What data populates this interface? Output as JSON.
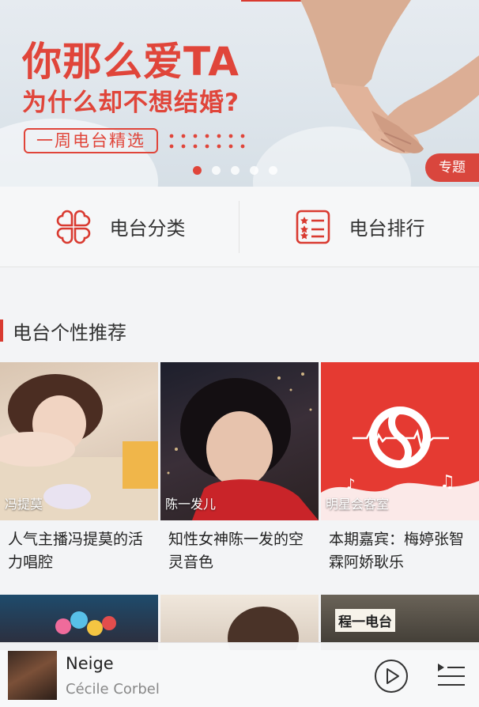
{
  "banner": {
    "title_line1": "你那么爱TA",
    "title_line2": "为什么却不想结婚?",
    "weekly_label": "一周电台精选",
    "tag": "专题",
    "active_slide": 1,
    "slide_count": 5
  },
  "entries": [
    {
      "label": "电台分类",
      "icon": "grid-icon"
    },
    {
      "label": "电台排行",
      "icon": "rank-list-icon"
    }
  ],
  "section": {
    "title": "电台个性推荐"
  },
  "cards": [
    {
      "caption": "冯提莫",
      "title": "人气主播冯提莫的活力唱腔"
    },
    {
      "caption": "陈一发儿",
      "title": "知性女神陈一发的空灵音色"
    },
    {
      "caption": "明星会客室",
      "title": "本期嘉宾：梅婷张智霖阿娇耿乐"
    }
  ],
  "row2_cards": [
    {
      "overlay_text": ""
    },
    {
      "overlay_text": ""
    },
    {
      "overlay_text": "程一电台"
    }
  ],
  "player": {
    "song": "Neige",
    "artist": "Cécile Corbel"
  },
  "colors": {
    "accent": "#d93a30",
    "text": "#222222",
    "muted": "#888888"
  }
}
